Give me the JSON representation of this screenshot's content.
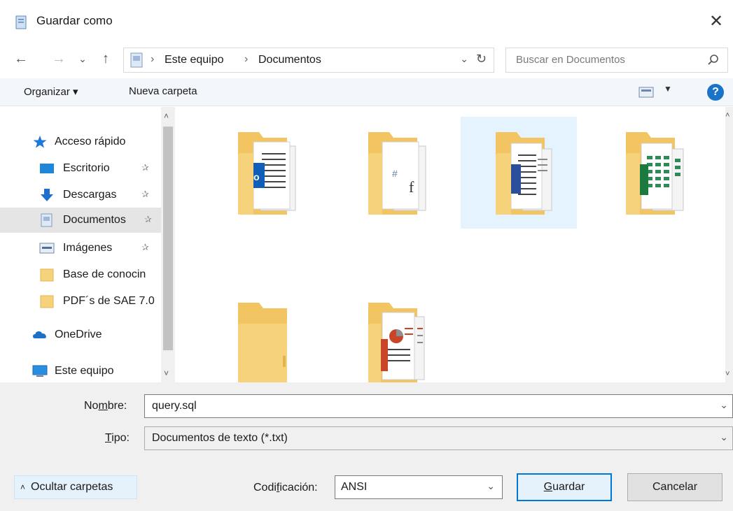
{
  "window": {
    "title": "Guardar como",
    "close_glyph": "✕"
  },
  "nav": {
    "back_glyph": "←",
    "forward_glyph": "→",
    "recent_glyph": "⌄",
    "up_glyph": "↑",
    "breadcrumb": [
      "Este equipo",
      "Documentos"
    ],
    "breadcrumb_sep": "›",
    "dropdown_glyph": "⌄",
    "refresh_glyph": "↻",
    "search_placeholder": "Buscar en Documentos"
  },
  "toolbar": {
    "organize": "Organizar ▾",
    "new_folder": "Nueva carpeta",
    "view_dropdown_glyph": "▼",
    "help_glyph": "?"
  },
  "sidebar": {
    "items": [
      {
        "label": "Acceso rápido",
        "icon": "star-icon",
        "pinned": false
      },
      {
        "label": "Escritorio",
        "icon": "desktop-icon",
        "pinned": true
      },
      {
        "label": "Descargas",
        "icon": "download-icon",
        "pinned": true
      },
      {
        "label": "Documentos",
        "icon": "documents-icon",
        "pinned": true,
        "selected": true
      },
      {
        "label": "Imágenes",
        "icon": "pictures-icon",
        "pinned": true
      },
      {
        "label": "Base de conocin",
        "icon": "folder-icon",
        "pinned": false
      },
      {
        "label": "PDF´s de SAE 7.0",
        "icon": "folder-icon",
        "pinned": false
      },
      {
        "label": "OneDrive",
        "icon": "cloud-icon",
        "pinned": false
      },
      {
        "label": "Este equipo",
        "icon": "computer-icon",
        "pinned": false
      }
    ],
    "pin_glyph": "✰",
    "scroll_up": "˄",
    "scroll_down": "˅"
  },
  "content": {
    "folders": [
      {
        "icon": "folder-outlook-icon",
        "accent": "#0f5fb8"
      },
      {
        "icon": "folder-files-icon",
        "accent": "#6a7fa0"
      },
      {
        "icon": "folder-word-icon",
        "accent": "#2b4f9a",
        "highlighted": true
      },
      {
        "icon": "folder-excel-icon",
        "accent": "#1d7a3e"
      },
      {
        "icon": "folder-empty-icon",
        "accent": "#f0c85a"
      },
      {
        "icon": "folder-powerpoint-icon",
        "accent": "#c9452a"
      }
    ],
    "scroll_up": "˄",
    "scroll_down": "˅"
  },
  "form": {
    "name_label_pre": "No",
    "name_label_u": "m",
    "name_label_post": "bre:",
    "name_value": "query.sql",
    "type_label_u": "T",
    "type_label_post": "ipo:",
    "type_value": "Documentos de texto (*.txt)",
    "hide_folders": "Ocultar carpetas",
    "hide_caret": "˄",
    "encoding_label_pre": "Codi",
    "encoding_label_u": "f",
    "encoding_label_post": "icación:",
    "encoding_value": "ANSI",
    "save_u": "G",
    "save_post": "uardar",
    "cancel": "Cancelar",
    "chev": "⌄"
  }
}
